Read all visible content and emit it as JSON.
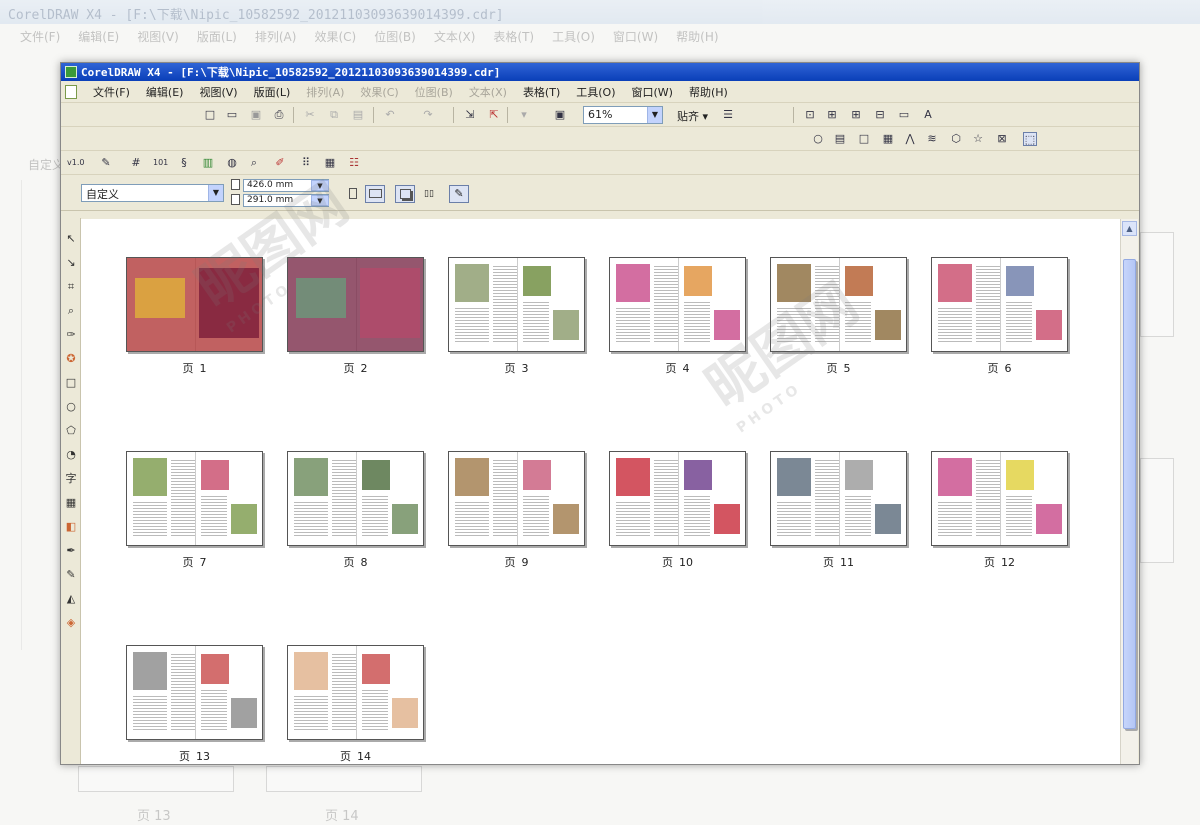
{
  "background_window": {
    "title": "CorelDRAW X4 - [F:\\下载\\Nipic_10582592_20121103093639014399.cdr]",
    "menus": [
      "文件(F)",
      "编辑(E)",
      "视图(V)",
      "版面(L)",
      "排列(A)",
      "效果(C)",
      "位图(B)",
      "文本(X)",
      "表格(T)",
      "工具(O)",
      "窗口(W)",
      "帮助(H)"
    ],
    "preset": "自定义",
    "page_labels": [
      "页 13",
      "页 14"
    ]
  },
  "window": {
    "title": "CorelDRAW X4 - [F:\\下载\\Nipic_10582592_20121103093639014399.cdr]"
  },
  "menubar": {
    "items": [
      {
        "label": "文件(F)",
        "enabled": true
      },
      {
        "label": "编辑(E)",
        "enabled": true
      },
      {
        "label": "视图(V)",
        "enabled": true
      },
      {
        "label": "版面(L)",
        "enabled": true
      },
      {
        "label": "排列(A)",
        "enabled": false
      },
      {
        "label": "效果(C)",
        "enabled": false
      },
      {
        "label": "位图(B)",
        "enabled": false
      },
      {
        "label": "文本(X)",
        "enabled": false
      },
      {
        "label": "表格(T)",
        "enabled": true
      },
      {
        "label": "工具(O)",
        "enabled": true
      },
      {
        "label": "窗口(W)",
        "enabled": true
      },
      {
        "label": "帮助(H)",
        "enabled": true
      }
    ]
  },
  "toolbar": {
    "zoom_value": "61%",
    "snap_label": "贴齐"
  },
  "property_bar": {
    "preset": "自定义",
    "width": "426.0 mm",
    "height": "291.0 mm"
  },
  "pages": [
    {
      "label": "页",
      "num": "1"
    },
    {
      "label": "页",
      "num": "2"
    },
    {
      "label": "页",
      "num": "3"
    },
    {
      "label": "页",
      "num": "4"
    },
    {
      "label": "页",
      "num": "5"
    },
    {
      "label": "页",
      "num": "6"
    },
    {
      "label": "页",
      "num": "7"
    },
    {
      "label": "页",
      "num": "8"
    },
    {
      "label": "页",
      "num": "9"
    },
    {
      "label": "页",
      "num": "10"
    },
    {
      "label": "页",
      "num": "11"
    },
    {
      "label": "页",
      "num": "12"
    },
    {
      "label": "页",
      "num": "13"
    },
    {
      "label": "页",
      "num": "14"
    }
  ],
  "watermark": {
    "text": "昵图网",
    "sub": "PHOTO"
  },
  "icons": [
    "new-icon",
    "open-icon",
    "save-icon",
    "print-icon",
    "cut-icon",
    "copy-icon",
    "paste-icon",
    "undo-icon",
    "redo-icon",
    "import-icon",
    "export-icon",
    "app-launcher-icon",
    "welcome-icon",
    "pick-tool-icon",
    "shape-tool-icon",
    "crop-tool-icon",
    "zoom-tool-icon",
    "freehand-tool-icon",
    "smart-fill-icon",
    "rectangle-tool-icon",
    "ellipse-tool-icon",
    "polygon-tool-icon",
    "basic-shapes-icon",
    "text-tool-icon",
    "table-tool-icon",
    "interactive-fill-icon",
    "eyedropper-icon",
    "outline-icon",
    "fill-icon"
  ]
}
